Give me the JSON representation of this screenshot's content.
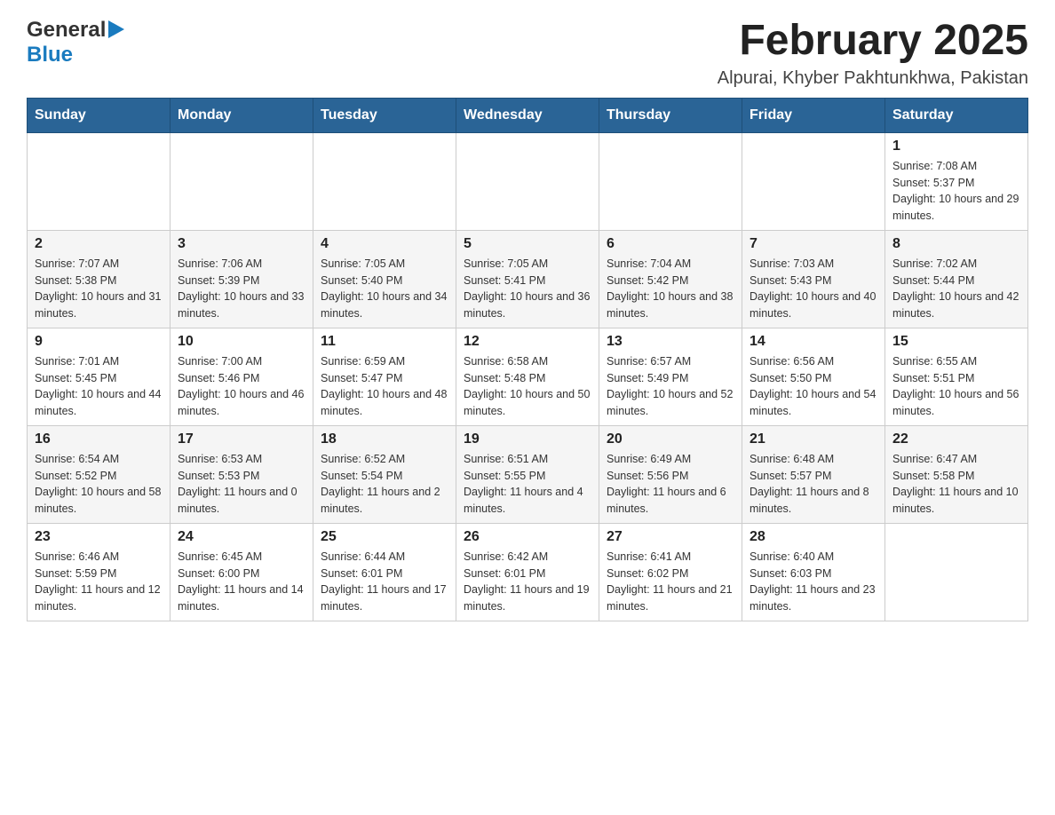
{
  "header": {
    "logo_general": "General",
    "logo_blue": "Blue",
    "title": "February 2025",
    "subtitle": "Alpurai, Khyber Pakhtunkhwa, Pakistan"
  },
  "weekdays": [
    "Sunday",
    "Monday",
    "Tuesday",
    "Wednesday",
    "Thursday",
    "Friday",
    "Saturday"
  ],
  "weeks": [
    [
      {
        "day": "",
        "info": ""
      },
      {
        "day": "",
        "info": ""
      },
      {
        "day": "",
        "info": ""
      },
      {
        "day": "",
        "info": ""
      },
      {
        "day": "",
        "info": ""
      },
      {
        "day": "",
        "info": ""
      },
      {
        "day": "1",
        "info": "Sunrise: 7:08 AM\nSunset: 5:37 PM\nDaylight: 10 hours and 29 minutes."
      }
    ],
    [
      {
        "day": "2",
        "info": "Sunrise: 7:07 AM\nSunset: 5:38 PM\nDaylight: 10 hours and 31 minutes."
      },
      {
        "day": "3",
        "info": "Sunrise: 7:06 AM\nSunset: 5:39 PM\nDaylight: 10 hours and 33 minutes."
      },
      {
        "day": "4",
        "info": "Sunrise: 7:05 AM\nSunset: 5:40 PM\nDaylight: 10 hours and 34 minutes."
      },
      {
        "day": "5",
        "info": "Sunrise: 7:05 AM\nSunset: 5:41 PM\nDaylight: 10 hours and 36 minutes."
      },
      {
        "day": "6",
        "info": "Sunrise: 7:04 AM\nSunset: 5:42 PM\nDaylight: 10 hours and 38 minutes."
      },
      {
        "day": "7",
        "info": "Sunrise: 7:03 AM\nSunset: 5:43 PM\nDaylight: 10 hours and 40 minutes."
      },
      {
        "day": "8",
        "info": "Sunrise: 7:02 AM\nSunset: 5:44 PM\nDaylight: 10 hours and 42 minutes."
      }
    ],
    [
      {
        "day": "9",
        "info": "Sunrise: 7:01 AM\nSunset: 5:45 PM\nDaylight: 10 hours and 44 minutes."
      },
      {
        "day": "10",
        "info": "Sunrise: 7:00 AM\nSunset: 5:46 PM\nDaylight: 10 hours and 46 minutes."
      },
      {
        "day": "11",
        "info": "Sunrise: 6:59 AM\nSunset: 5:47 PM\nDaylight: 10 hours and 48 minutes."
      },
      {
        "day": "12",
        "info": "Sunrise: 6:58 AM\nSunset: 5:48 PM\nDaylight: 10 hours and 50 minutes."
      },
      {
        "day": "13",
        "info": "Sunrise: 6:57 AM\nSunset: 5:49 PM\nDaylight: 10 hours and 52 minutes."
      },
      {
        "day": "14",
        "info": "Sunrise: 6:56 AM\nSunset: 5:50 PM\nDaylight: 10 hours and 54 minutes."
      },
      {
        "day": "15",
        "info": "Sunrise: 6:55 AM\nSunset: 5:51 PM\nDaylight: 10 hours and 56 minutes."
      }
    ],
    [
      {
        "day": "16",
        "info": "Sunrise: 6:54 AM\nSunset: 5:52 PM\nDaylight: 10 hours and 58 minutes."
      },
      {
        "day": "17",
        "info": "Sunrise: 6:53 AM\nSunset: 5:53 PM\nDaylight: 11 hours and 0 minutes."
      },
      {
        "day": "18",
        "info": "Sunrise: 6:52 AM\nSunset: 5:54 PM\nDaylight: 11 hours and 2 minutes."
      },
      {
        "day": "19",
        "info": "Sunrise: 6:51 AM\nSunset: 5:55 PM\nDaylight: 11 hours and 4 minutes."
      },
      {
        "day": "20",
        "info": "Sunrise: 6:49 AM\nSunset: 5:56 PM\nDaylight: 11 hours and 6 minutes."
      },
      {
        "day": "21",
        "info": "Sunrise: 6:48 AM\nSunset: 5:57 PM\nDaylight: 11 hours and 8 minutes."
      },
      {
        "day": "22",
        "info": "Sunrise: 6:47 AM\nSunset: 5:58 PM\nDaylight: 11 hours and 10 minutes."
      }
    ],
    [
      {
        "day": "23",
        "info": "Sunrise: 6:46 AM\nSunset: 5:59 PM\nDaylight: 11 hours and 12 minutes."
      },
      {
        "day": "24",
        "info": "Sunrise: 6:45 AM\nSunset: 6:00 PM\nDaylight: 11 hours and 14 minutes."
      },
      {
        "day": "25",
        "info": "Sunrise: 6:44 AM\nSunset: 6:01 PM\nDaylight: 11 hours and 17 minutes."
      },
      {
        "day": "26",
        "info": "Sunrise: 6:42 AM\nSunset: 6:01 PM\nDaylight: 11 hours and 19 minutes."
      },
      {
        "day": "27",
        "info": "Sunrise: 6:41 AM\nSunset: 6:02 PM\nDaylight: 11 hours and 21 minutes."
      },
      {
        "day": "28",
        "info": "Sunrise: 6:40 AM\nSunset: 6:03 PM\nDaylight: 11 hours and 23 minutes."
      },
      {
        "day": "",
        "info": ""
      }
    ]
  ],
  "colors": {
    "header_bg": "#2a6496",
    "header_text": "#ffffff",
    "border": "#cccccc"
  }
}
